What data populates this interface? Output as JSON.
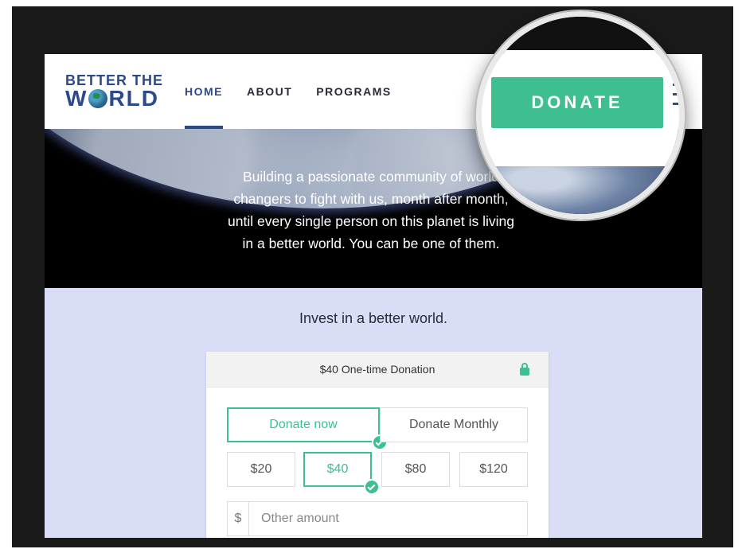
{
  "header": {
    "logo_line1": "BETTER THE",
    "logo_line2_prefix": "W",
    "logo_line2_suffix": "RLD",
    "nav": [
      {
        "label": "HOME",
        "active": true
      },
      {
        "label": "ABOUT",
        "active": false
      },
      {
        "label": "PROGRAMS",
        "active": false
      }
    ],
    "donate_label": "DONATE"
  },
  "hero": {
    "lines": [
      "Building a passionate community of world",
      "changers to fight with us, month after month,",
      "until every single person on this planet is living",
      "in a better world. You can be one of them."
    ]
  },
  "donation": {
    "section_title": "Invest in a better world.",
    "card_title": "$40 One-time Donation",
    "frequency": [
      {
        "label": "Donate now",
        "selected": true
      },
      {
        "label": "Donate Monthly",
        "selected": false
      }
    ],
    "amounts": [
      {
        "label": "$20",
        "selected": false
      },
      {
        "label": "$40",
        "selected": true
      },
      {
        "label": "$80",
        "selected": false
      },
      {
        "label": "$120",
        "selected": false
      }
    ],
    "currency_symbol": "$",
    "other_placeholder": "Other amount"
  },
  "colors": {
    "brand_blue": "#2c4a8a",
    "accent_green": "#3dbf8f",
    "section_bg": "#d9ddf6"
  }
}
